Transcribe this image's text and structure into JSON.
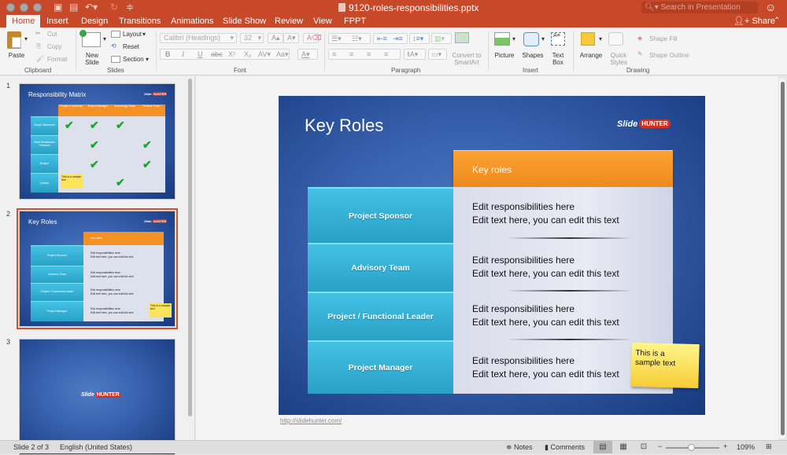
{
  "window": {
    "title": "9120-roles-responsibilities.pptx",
    "search_placeholder": "Search in Presentation"
  },
  "tabs": [
    {
      "label": "Home",
      "active": true
    },
    {
      "label": "Insert"
    },
    {
      "label": "Design"
    },
    {
      "label": "Transitions"
    },
    {
      "label": "Animations"
    },
    {
      "label": "Slide Show"
    },
    {
      "label": "Review"
    },
    {
      "label": "View"
    },
    {
      "label": "FPPT"
    }
  ],
  "share_label": "Share",
  "ribbon": {
    "clipboard": {
      "group": "Clipboard",
      "paste": "Paste",
      "cut": "Cut",
      "copy": "Copy",
      "format": "Format"
    },
    "slides": {
      "group": "Slides",
      "new_slide": "New Slide",
      "layout": "Layout",
      "reset": "Reset",
      "section": "Section"
    },
    "font": {
      "group": "Font",
      "font_name": "Calibri (Headings)",
      "font_size": "32"
    },
    "paragraph": {
      "group": "Paragraph",
      "convert": "Convert to SmartArt"
    },
    "insert": {
      "group": "Insert",
      "picture": "Picture",
      "shapes": "Shapes",
      "text_box": "Text Box"
    },
    "drawing": {
      "group": "Drawing",
      "arrange": "Arrange",
      "quick_styles": "Quick Styles",
      "shape_fill": "Shape Fill",
      "shape_outline": "Shape Outline"
    }
  },
  "thumbnails": [
    {
      "number": "1",
      "title": "Responsibility Matrix",
      "columns": [
        "Project Chartering",
        "Project Manager",
        "Technology Team",
        "Finance Team"
      ],
      "rows": [
        "Scope Statement",
        "Work Breakdown Structure",
        "Budget",
        "Quality"
      ],
      "sticky": "This is a sample text"
    },
    {
      "number": "2",
      "title": "Key Roles",
      "selected": true
    },
    {
      "number": "3",
      "logo": "Slide HUNTER"
    }
  ],
  "slide": {
    "title": "Key Roles",
    "logo_text": "Slide",
    "logo_badge": "HUNTER",
    "header": "Key roles",
    "roles": [
      {
        "name": "Project Sponsor",
        "line1": "Edit responsibilities here",
        "line2": "Edit text here, you can edit this text"
      },
      {
        "name": "Advisory Team",
        "line1": "Edit responsibilities here",
        "line2": "Edit text here, you can edit this text"
      },
      {
        "name": "Project / Functional Leader",
        "line1": "Edit responsibilities here",
        "line2": "Edit text here, you can edit this text"
      },
      {
        "name": "Project Manager",
        "line1": "Edit responsibilities here",
        "line2": "Edit text here, you can edit this text"
      }
    ],
    "sticky_line1": "This is a",
    "sticky_line2": "sample text",
    "link": "http://slidehunter.com/"
  },
  "status": {
    "slide_pos": "Slide 2 of 3",
    "language": "English (United States)",
    "notes": "Notes",
    "comments": "Comments",
    "zoom": "109%"
  },
  "colors": {
    "accent": "#c8492a",
    "orange_header": "#f39125",
    "cyan_role": "#36b3d8",
    "slide_blue": "#2e56a2"
  }
}
